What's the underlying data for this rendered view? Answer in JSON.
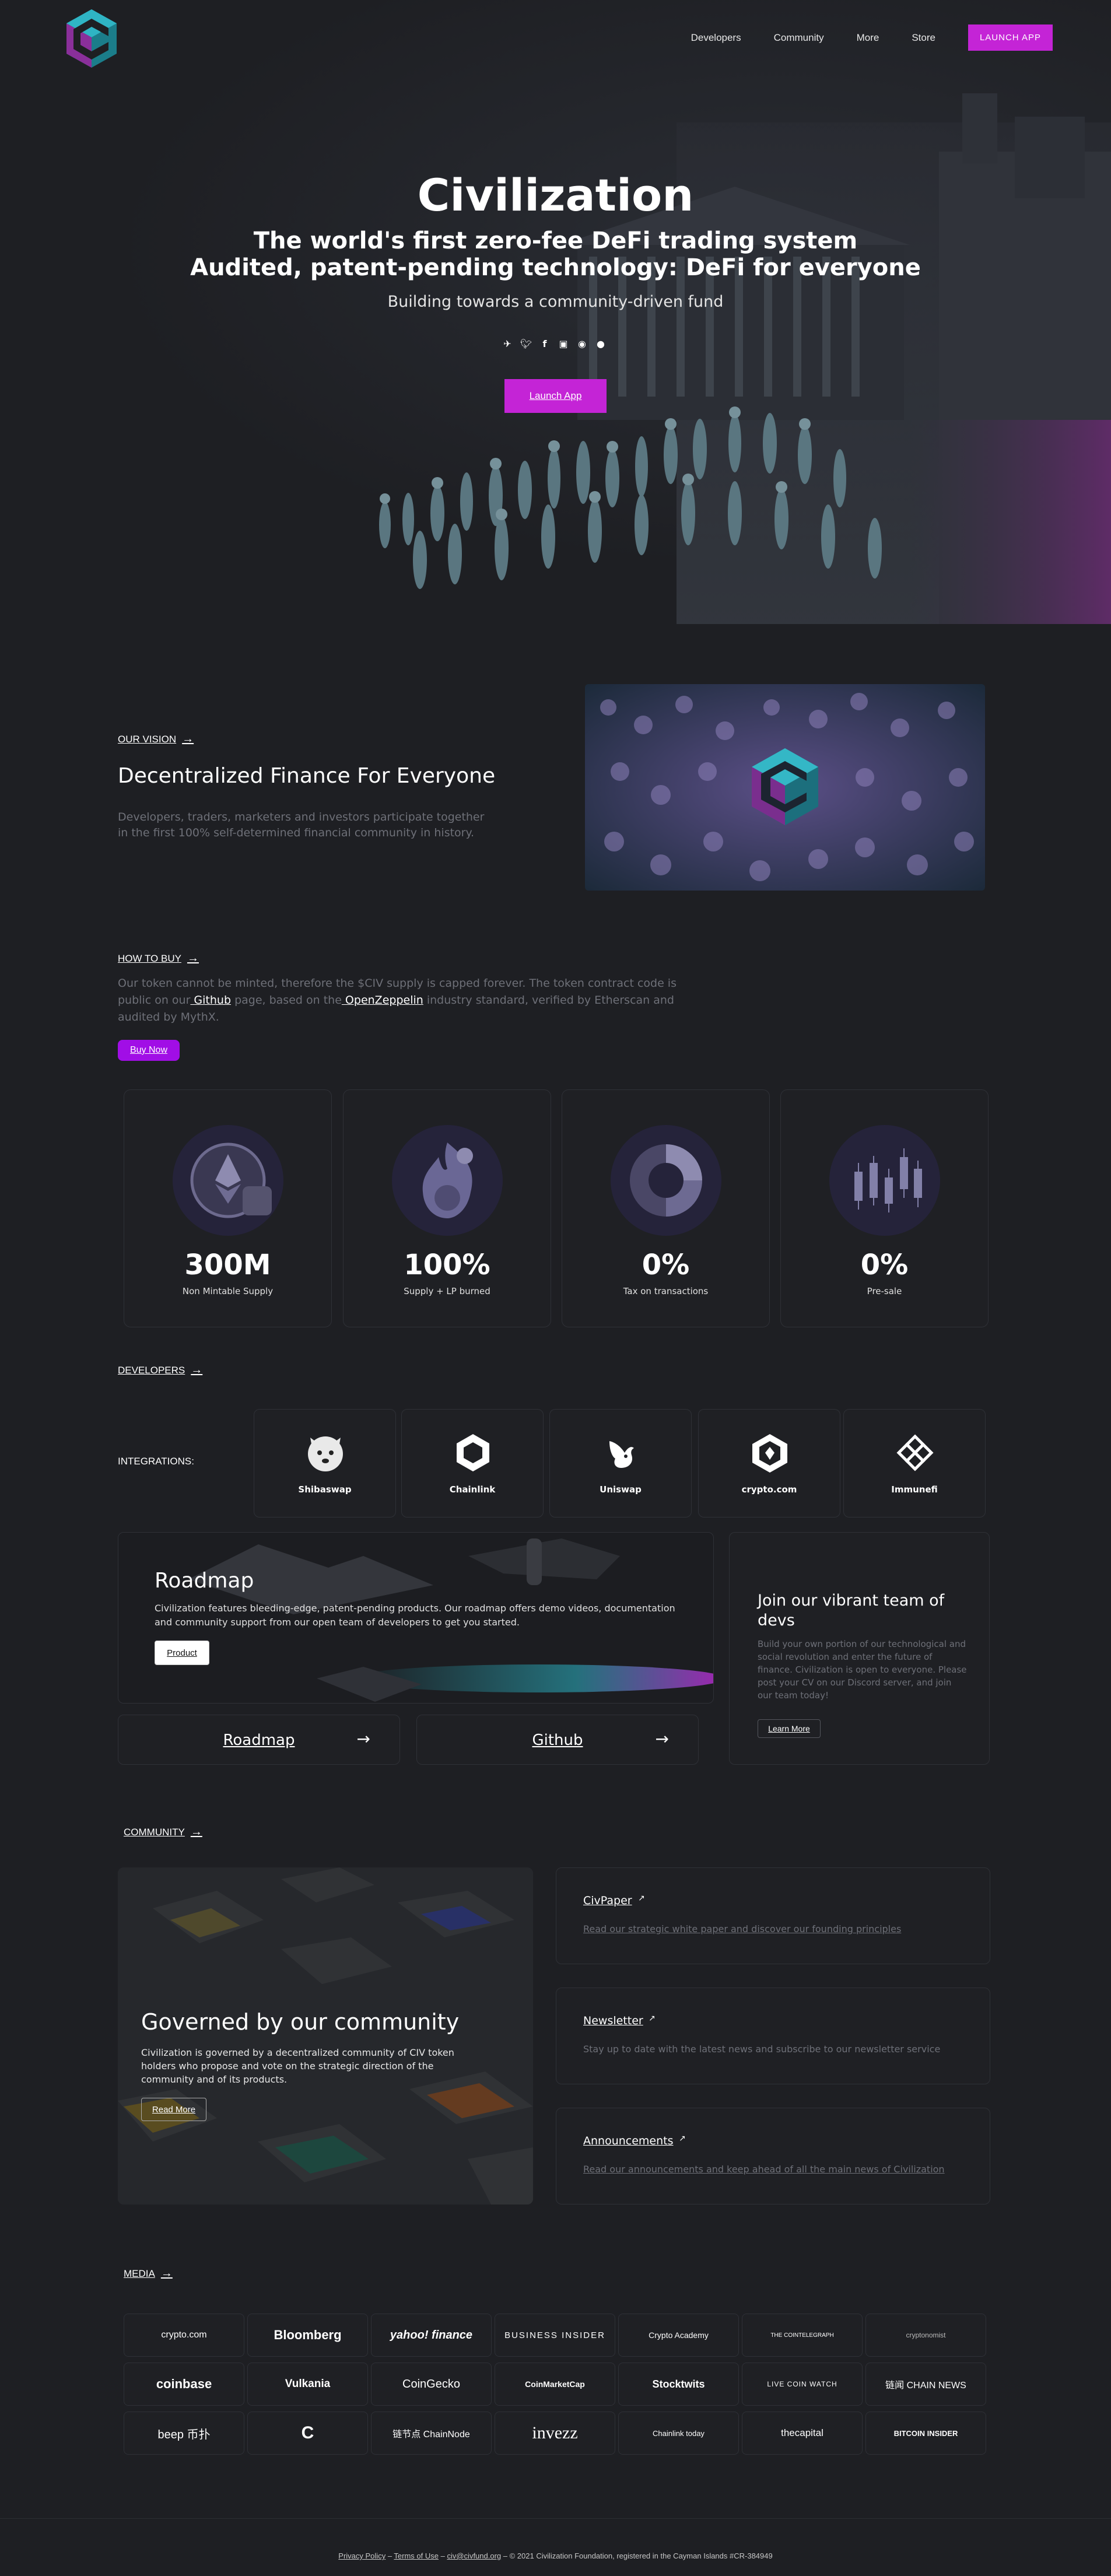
{
  "nav": {
    "links": [
      "Developers",
      "Community",
      "More",
      "Store"
    ],
    "launch_label": "LAUNCH APP"
  },
  "hero": {
    "title": "Civilization",
    "subtitle_1": "The world's first zero-fee DeFi trading system",
    "subtitle_2": "Audited, patent-pending technology: DeFi for everyone",
    "subtitle_3": "Building towards a community-driven fund",
    "socials": [
      "telegram-icon",
      "twitter-icon",
      "facebook-icon",
      "medium-icon",
      "reddit-icon",
      "github-icon"
    ],
    "cta_label": "Launch App"
  },
  "vision": {
    "label": "OUR VISION",
    "title": "Decentralized Finance For Everyone",
    "text": "Developers, traders, marketers and investors participate together in the first 100% self-determined financial community in history."
  },
  "buy": {
    "label": "HOW TO BUY",
    "text_1": "Our token cannot be minted, therefore the $CIV supply is capped forever. The token contract code is public on our",
    "link_github": " Github",
    "text_2": " page, based on the",
    "link_oz": " OpenZeppelin",
    "text_3": " industry standard, verified by Etherscan and audited by MythX.",
    "button_label": "Buy Now",
    "stats": [
      {
        "value": "300M",
        "label": "Non Mintable Supply"
      },
      {
        "value": "100%",
        "label": "Supply + LP burned"
      },
      {
        "value": "0%",
        "label": "Tax on transactions"
      },
      {
        "value": "0%",
        "label": "Pre-sale"
      }
    ]
  },
  "developers": {
    "label": "DEVELOPERS",
    "integrations_label": "INTEGRATIONS:",
    "integrations": [
      "Shibaswap",
      "Chainlink",
      "Uniswap",
      "crypto.com",
      "Immunefi"
    ],
    "roadmap": {
      "title": "Roadmap",
      "text": "Civilization features bleeding-edge, patent-pending products. Our roadmap offers demo videos, documentation and community support from our open team of developers to get you started.",
      "button_label": "Product"
    },
    "link_roadmap": "Roadmap",
    "link_github": "Github",
    "join": {
      "title": "Join our vibrant team of devs",
      "text": "Build your own portion of our technological and social revolution and enter the future of finance. Civilization is open to everyone. Please post your CV on our Discord server, and join our team today!",
      "button_label": "Learn More"
    }
  },
  "community": {
    "label": "COMMUNITY",
    "gov": {
      "title": "Governed by our community",
      "text": "Civilization is governed by a decentralized community of CIV token holders who propose and vote on the strategic direction of the community and of its products.",
      "button_label": "Read More"
    },
    "cards": [
      {
        "title": "CivPaper",
        "desc": "Read our strategic white paper and discover our founding principles"
      },
      {
        "title": "Newsletter",
        "desc": "Stay up to date with the latest news and subscribe to our newsletter service"
      },
      {
        "title": "Announcements",
        "desc": "Read our announcements and keep ahead of all the main news of Civilization"
      }
    ]
  },
  "media": {
    "label": "MEDIA",
    "logos": [
      "crypto.com",
      "Bloomberg",
      "yahoo! finance",
      "BUSINESS INSIDER",
      "Crypto Academy",
      "THE COINTELEGRAPH",
      "cryptonomist",
      "coinbase",
      "Vulkania",
      "CoinGecko",
      "CoinMarketCap",
      "Stocktwits",
      "LIVE COIN WATCH",
      "链闻 CHAIN NEWS",
      "beep 币扑",
      "C",
      "链节点 ChainNode",
      "invezz",
      "Chainlink today",
      "thecapital",
      "BITCOIN INSIDER"
    ]
  },
  "footer": {
    "privacy": "Privacy Policy",
    "sep1": " – ",
    "terms": "Terms of Use",
    "sep2": " – ",
    "email": "civ@civfund.org",
    "rest": " – © 2021 Civilization Foundation, registered in the Cayman Islands #CR-384949"
  },
  "colors": {
    "accent": "#c424d6",
    "accent_buy": "#a10ee6",
    "background": "#1e1f23",
    "muted_text": "#6e7078"
  }
}
